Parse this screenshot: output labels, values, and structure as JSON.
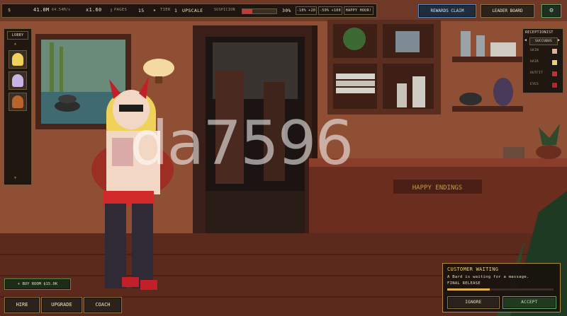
{
  "top_bar": {
    "money_icon": "dollar-icon",
    "money": "41.0M",
    "income_rate": "64.54M/s",
    "multiplier": "x1.60",
    "pages_label": "PAGES",
    "pages_value": "15",
    "tier_label": "TIER",
    "tier_value": "1",
    "upscale_label": "UPSCALE",
    "suspicion_label": "SUSPICION",
    "suspicion_percent_text": "30%",
    "suspicion_level": 0.3,
    "suspicion_color": "#c23b3b",
    "buttons": [
      {
        "label": "-10% +20"
      },
      {
        "label": "-50% +100"
      },
      {
        "label": "HAPPY HOUR!"
      }
    ]
  },
  "header_buttons": {
    "rewards": "REWARDS CLAIM",
    "leaderboard": "LEADER BOARD",
    "settings_icon": "gear-icon"
  },
  "lobby": {
    "title": "LOBBY",
    "scroll_up": "▲",
    "scroll_down": "▼"
  },
  "receptionist": {
    "title": "RECEPTIONIST",
    "selector_left": "◀",
    "selector_value": "SUCCUBUS",
    "selector_right": "▶",
    "options": [
      {
        "label": "SKIN",
        "color": "#e8b08a"
      },
      {
        "label": "HAIR",
        "color": "#f0d25a"
      },
      {
        "label": "OUTFIT",
        "color": "#d22a2a"
      },
      {
        "label": "EYES",
        "color": "#c91f1f"
      }
    ]
  },
  "scene": {
    "sign": "HAPPY ENDINGS",
    "watermark": "da7596"
  },
  "bottom_left": {
    "buy_room": "+ BUY ROOM $15.0K",
    "hire": "HIRE",
    "upgrade": "UPGRADE",
    "coach": "COACH"
  },
  "customer": {
    "title": "CUSTOMER WAITING",
    "message": "A Bard is waiting for a massage.",
    "service": "FINAL RELEASE",
    "ignore": "IGNORE",
    "accept": "ACCEPT",
    "accent": "#e0b04a"
  }
}
